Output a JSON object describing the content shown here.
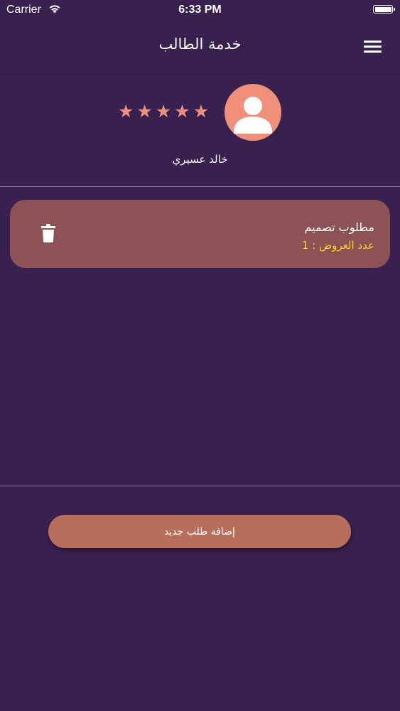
{
  "status_bar": {
    "carrier": "Carrier",
    "time": "6:33 PM"
  },
  "header": {
    "title": "خدمة الطالب",
    "menu_icon": "hamburger-menu-icon"
  },
  "profile": {
    "name": "خالد عسيري",
    "rating": 5,
    "max_rating": 5,
    "star_glyph": "★",
    "avatar_icon": "person-icon"
  },
  "requests": [
    {
      "title": "مطلوب تصميم",
      "offers_label": "عدد العروض : 1",
      "delete_icon": "trash-icon"
    }
  ],
  "actions": {
    "add_request_label": "إضافة طلب جديد"
  },
  "colors": {
    "background": "#38204f",
    "accent": "#f0907a",
    "card": "#8c5254",
    "offers_text": "#ffcc33",
    "button": "#b86e5c"
  }
}
